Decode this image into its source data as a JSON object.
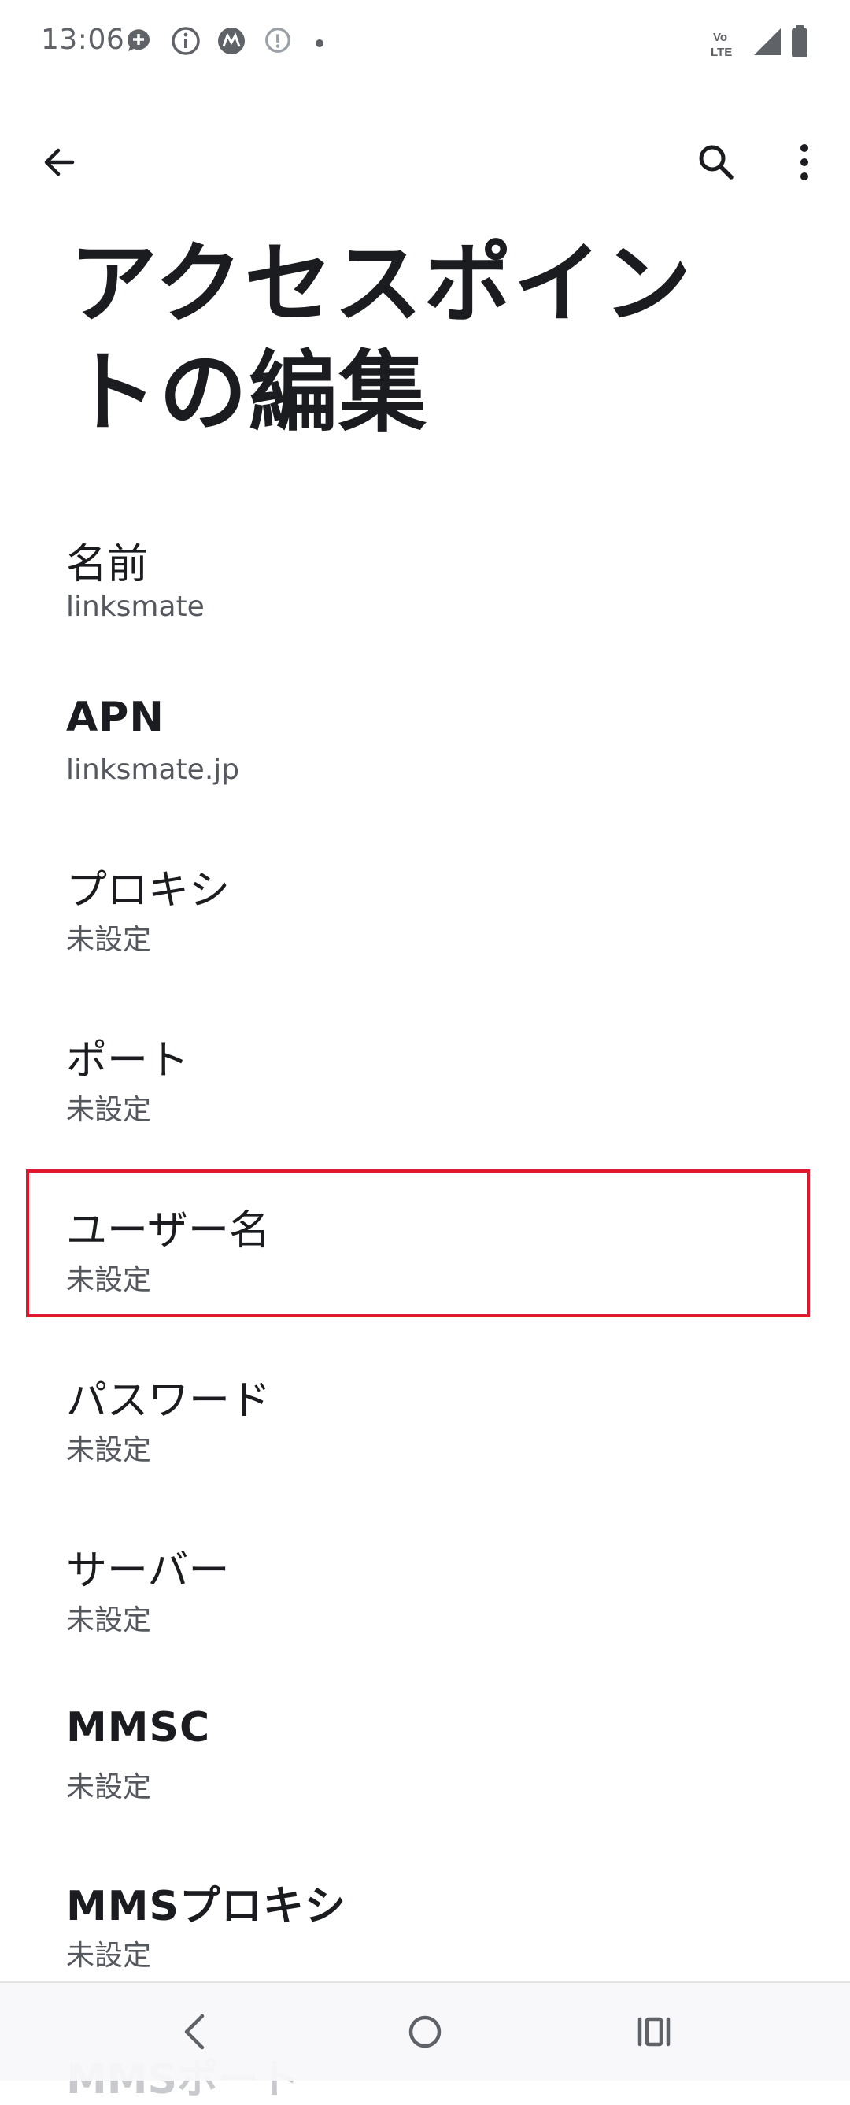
{
  "status_bar": {
    "time": "13:06",
    "left_icons": [
      "chat-plus-icon",
      "info-icon",
      "motorola-icon",
      "info-small-icon",
      "dot-icon"
    ],
    "right_icons": [
      "volte-icon",
      "signal-icon",
      "battery-icon"
    ],
    "volte_label_top": "Vo",
    "volte_label_bottom": "LTE"
  },
  "app_bar": {
    "back_icon": "arrow-back-icon",
    "search_icon": "search-icon",
    "more_icon": "more-vert-icon"
  },
  "page_title": "アクセスポイントの編集",
  "settings": [
    {
      "title": "名前",
      "summary": "linksmate"
    },
    {
      "title": "APN",
      "summary": "linksmate.jp"
    },
    {
      "title": "プロキシ",
      "summary": "未設定"
    },
    {
      "title": "ポート",
      "summary": "未設定"
    },
    {
      "title": "ユーザー名",
      "summary": "未設定"
    },
    {
      "title": "パスワード",
      "summary": "未設定"
    },
    {
      "title": "サーバー",
      "summary": "未設定"
    },
    {
      "title": "MMSC",
      "summary": "未設定"
    },
    {
      "title": "MMSプロキシ",
      "summary": "未設定"
    },
    {
      "title": "MMSポート",
      "summary": ""
    }
  ],
  "highlight": {
    "color": "#e0182d",
    "target": "ユーザー名"
  },
  "nav_bar": {
    "back_icon": "nav-back-icon",
    "home_icon": "nav-home-icon",
    "recents_icon": "nav-recents-icon"
  }
}
